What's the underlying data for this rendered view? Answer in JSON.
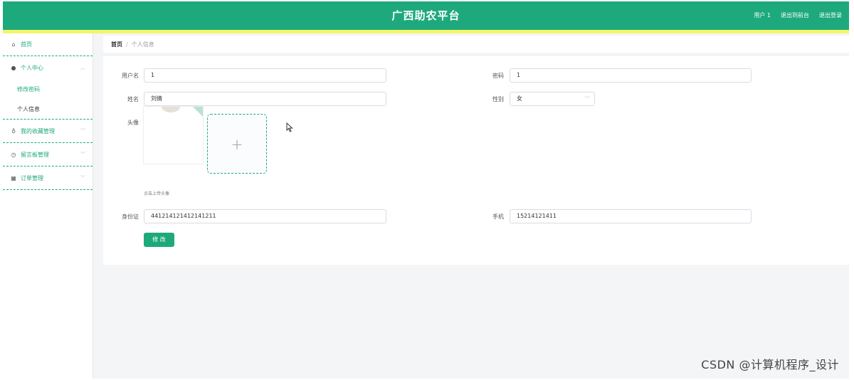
{
  "header": {
    "title": "广西助农平台",
    "links": [
      "用户 1",
      "退出到前台",
      "退出登录"
    ]
  },
  "sidebar": {
    "home": "首页",
    "personal_center": "个人中心",
    "sub_items": [
      "修改密码",
      "个人信息"
    ],
    "favorites": "我的收藏管理",
    "messages": "留言板管理",
    "orders": "订单管理"
  },
  "breadcrumb": {
    "home": "首页",
    "separator": "/",
    "current": "个人信息"
  },
  "form": {
    "username_label": "用户名",
    "username_value": "1",
    "password_label": "密码",
    "password_value": "1",
    "name_label": "姓名",
    "name_value": "刘倩",
    "gender_label": "性别",
    "gender_value": "女",
    "avatar_label": "头像",
    "upload_plus": "+",
    "upload_hint": "点击上传头像",
    "idcard_label": "身份证",
    "idcard_value": "441214121412141211",
    "phone_label": "手机",
    "phone_value": "15214121411",
    "submit_label": "修 改"
  },
  "watermark": "CSDN @计算机程序_设计",
  "colors": {
    "primary": "#1ea97c",
    "accent_strip": "#f5f56b",
    "background": "#f4f5f7"
  }
}
